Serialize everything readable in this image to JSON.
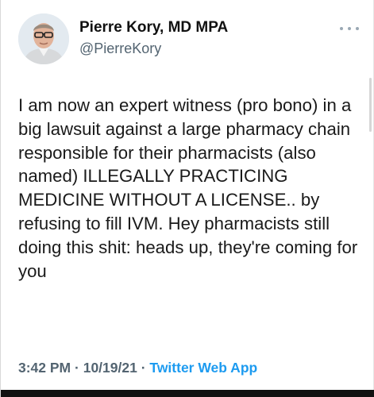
{
  "author": {
    "name": "Pierre Kory, MD MPA",
    "handle": "@PierreKory"
  },
  "tweet": {
    "text": "I am now an expert witness (pro bono) in a big lawsuit against a large pharmacy chain responsible for their pharmacists (also named) ILLEGALLY PRACTICING MEDICINE WITHOUT A LICENSE.. by refusing to fill IVM. Hey pharmacists still doing this shit: heads up, they're coming for you",
    "time": "3:42 PM",
    "separator": "·",
    "date": "10/19/21",
    "app": "Twitter Web App"
  },
  "icons": {
    "more": "more-options-icon",
    "avatar": "profile-photo"
  },
  "colors": {
    "link": "#1d9bf0",
    "secondary_text": "#536471",
    "primary_text": "#0f1419"
  }
}
